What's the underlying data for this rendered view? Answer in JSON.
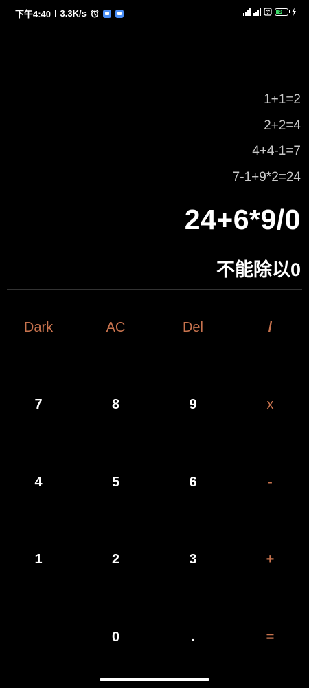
{
  "status_bar": {
    "time": "下午4:40",
    "network_speed": "3.3K/s",
    "battery_level": "60",
    "battery_fraction": 0.6,
    "icons": [
      "alarm-icon",
      "notification-icon",
      "notification-icon",
      "signal-icon",
      "signal-icon",
      "wifi-icon",
      "battery-icon",
      "charging-icon"
    ]
  },
  "display": {
    "history": [
      "1+1=2",
      "2+2=4",
      "4+4-1=7",
      "7-1+9*2=24"
    ],
    "expression": "24+6*9/0",
    "result": "不能除以0"
  },
  "keypad": {
    "row1": [
      "Dark",
      "AC",
      "Del",
      "/"
    ],
    "row2": [
      "7",
      "8",
      "9",
      "x"
    ],
    "row3": [
      "4",
      "5",
      "6",
      "-"
    ],
    "row4": [
      "1",
      "2",
      "3",
      "+"
    ],
    "row5": [
      "0",
      ".",
      "="
    ]
  },
  "colors": {
    "background": "#000000",
    "operator_accent": "#c8734e",
    "text_primary": "#ffffff",
    "history_text": "#c9c9c9"
  }
}
